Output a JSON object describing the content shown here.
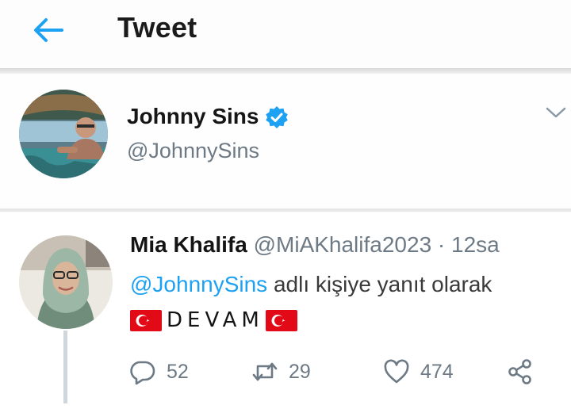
{
  "header": {
    "title": "Tweet",
    "back_icon": "arrow-left-icon",
    "accent": "#1da1f2"
  },
  "main_tweet": {
    "author_name": "Johnny Sins",
    "author_handle": "@JohnnySins",
    "verified": true,
    "verified_icon": "verified-badge-icon",
    "menu_icon": "chevron-down-icon"
  },
  "reply": {
    "author_name": "Mia Khalifa",
    "author_handle": "@MiAKhalifa2023",
    "separator": "·",
    "time": "12sa",
    "mention": "@JohnnySins",
    "context_text": "adlı kişiye yanıt olarak",
    "text": "DEVAM",
    "flag_icon": "turkey-flag-icon",
    "actions": {
      "replies": "52",
      "retweets": "29",
      "likes": "474"
    },
    "action_icons": [
      "reply-icon",
      "retweet-icon",
      "like-icon",
      "share-icon"
    ]
  }
}
